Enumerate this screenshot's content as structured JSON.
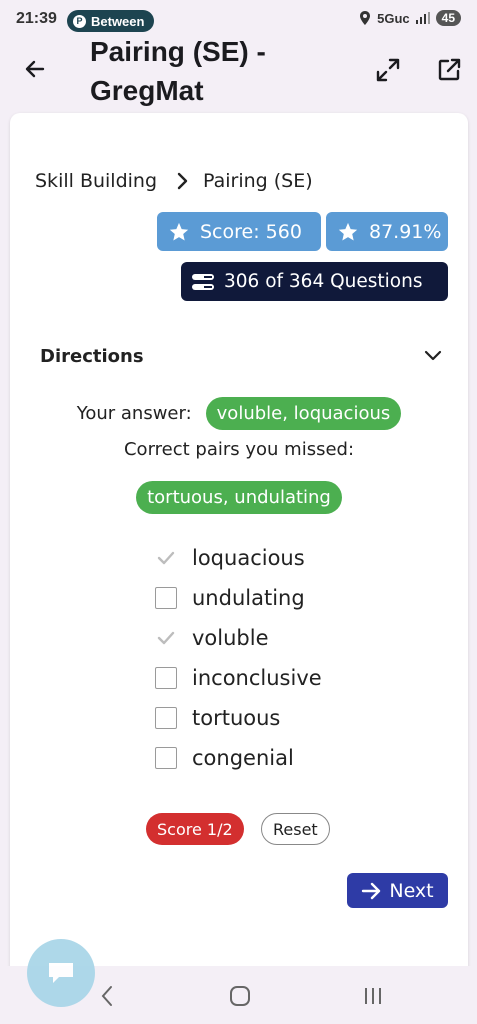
{
  "status_bar": {
    "time": "21:39",
    "chip_label": "Between",
    "network": "5Guc",
    "battery": "45"
  },
  "header": {
    "title": "Pairing (SE) - GregMat"
  },
  "breadcrumb": {
    "parent": "Skill Building",
    "current": "Pairing (SE)"
  },
  "stats": {
    "score": "Score: 560",
    "percent": "87.91%",
    "questions": "306 of 364 Questions"
  },
  "directions": {
    "label": "Directions"
  },
  "feedback": {
    "your_answer_label": "Your answer:",
    "your_answer": "voluble, loquacious",
    "missed_label": "Correct pairs you missed:",
    "missed": "tortuous, undulating"
  },
  "options": [
    {
      "label": "loquacious",
      "checked": true
    },
    {
      "label": "undulating",
      "checked": false
    },
    {
      "label": "voluble",
      "checked": true
    },
    {
      "label": "inconclusive",
      "checked": false
    },
    {
      "label": "tortuous",
      "checked": false
    },
    {
      "label": "congenial",
      "checked": false
    }
  ],
  "actions": {
    "score": "Score 1/2",
    "reset": "Reset",
    "next": "Next"
  },
  "colors": {
    "badge_blue": "#5b9bd5",
    "badge_navy": "#10193a",
    "green": "#4caf50",
    "red": "#d32f2f",
    "next_blue": "#2e3ba6"
  }
}
